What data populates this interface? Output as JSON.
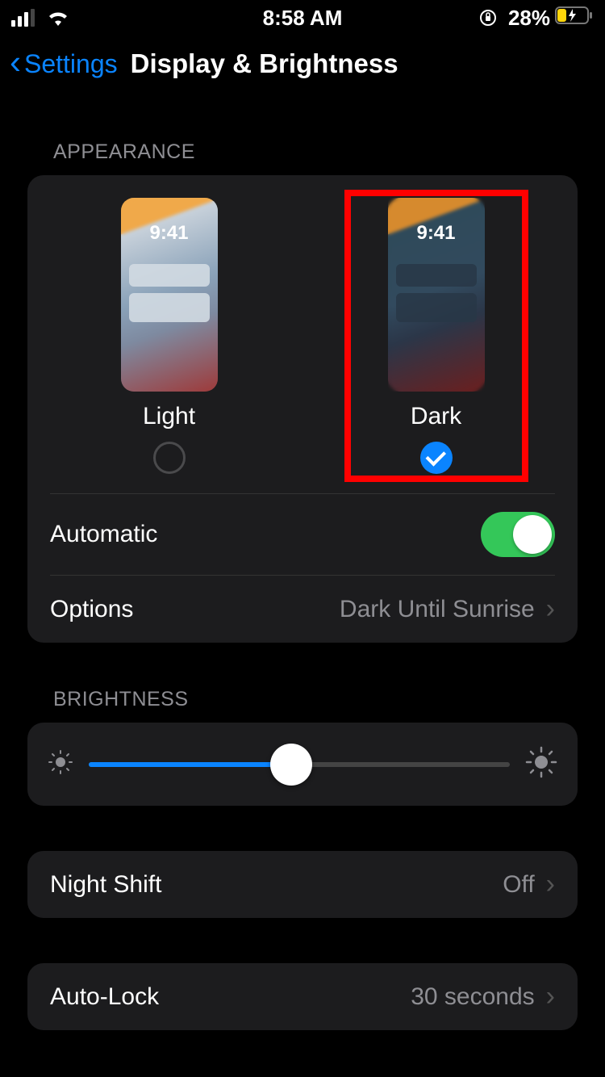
{
  "statusBar": {
    "time": "8:58 AM",
    "batteryPercent": "28%"
  },
  "nav": {
    "back": "Settings",
    "title": "Display & Brightness"
  },
  "appearance": {
    "header": "APPEARANCE",
    "previewTime": "9:41",
    "light": {
      "label": "Light",
      "selected": false
    },
    "dark": {
      "label": "Dark",
      "selected": true
    },
    "automatic": {
      "label": "Automatic",
      "on": true
    },
    "options": {
      "label": "Options",
      "value": "Dark Until Sunrise"
    }
  },
  "brightness": {
    "header": "BRIGHTNESS",
    "value": 0.48
  },
  "nightShift": {
    "label": "Night Shift",
    "value": "Off"
  },
  "autoLock": {
    "label": "Auto-Lock",
    "value": "30 seconds"
  }
}
